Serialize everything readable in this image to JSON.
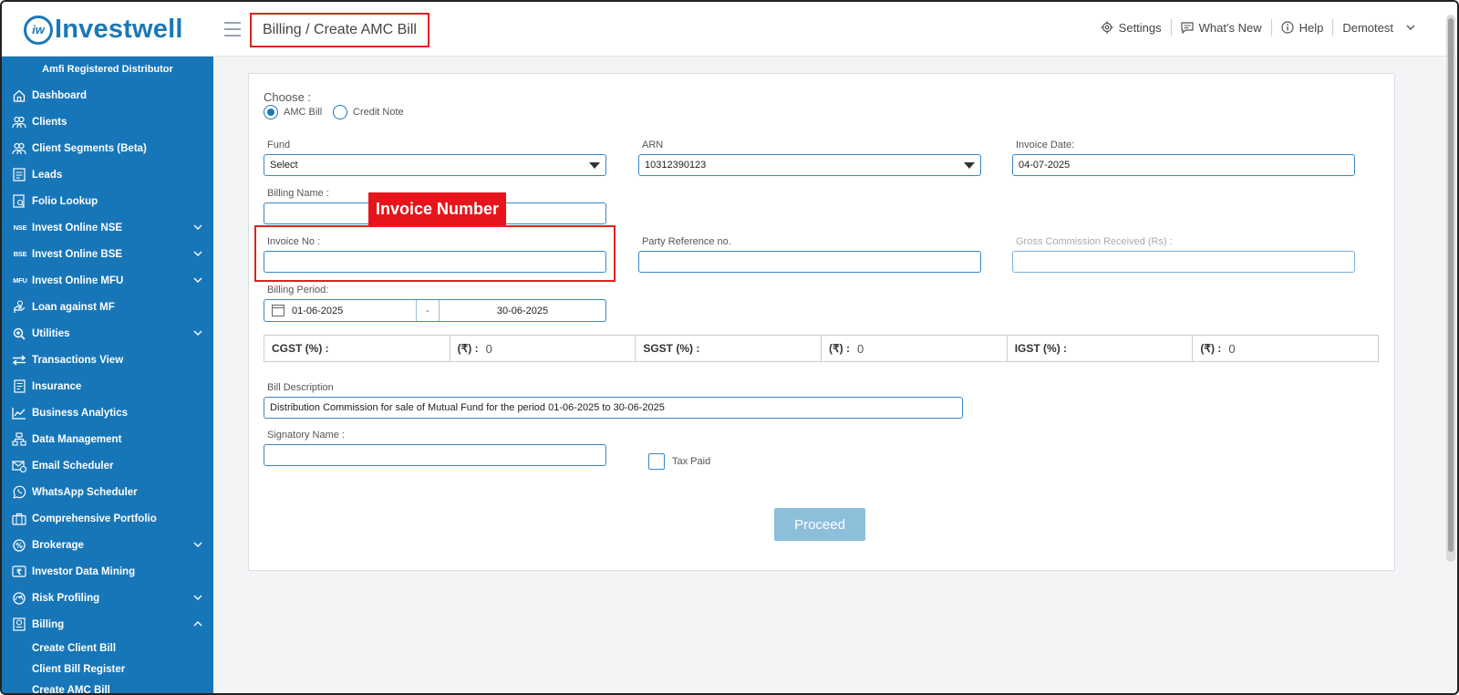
{
  "header": {
    "logo_mark": "iw",
    "logo_text": "Investwell",
    "breadcrumb": "Billing / Create AMC Bill",
    "settings": "Settings",
    "whats_new": "What's New",
    "help": "Help",
    "user": "Demotest"
  },
  "sidebar": {
    "role": "Amfi Registered Distributor",
    "items": [
      {
        "label": "Dashboard",
        "icon": "home-icon"
      },
      {
        "label": "Clients",
        "icon": "users-icon"
      },
      {
        "label": "Client Segments (Beta)",
        "icon": "users-icon"
      },
      {
        "label": "Leads",
        "icon": "leads-icon"
      },
      {
        "label": "Folio Lookup",
        "icon": "folio-icon"
      },
      {
        "label": "Invest Online NSE",
        "icon_text": "NSE"
      },
      {
        "label": "Invest Online BSE",
        "icon_text": "BSE"
      },
      {
        "label": "Invest Online MFU",
        "icon_text": "MFU"
      },
      {
        "label": "Loan against MF",
        "icon": "loan-icon"
      },
      {
        "label": "Utilities",
        "icon": "utilities-icon"
      },
      {
        "label": "Transactions View",
        "icon": "transactions-icon"
      },
      {
        "label": "Insurance",
        "icon": "insurance-icon"
      },
      {
        "label": "Business Analytics",
        "icon": "analytics-icon"
      },
      {
        "label": "Data Management",
        "icon": "data-icon"
      },
      {
        "label": "Email Scheduler",
        "icon": "email-icon"
      },
      {
        "label": "WhatsApp Scheduler",
        "icon": "whatsapp-icon"
      },
      {
        "label": "Comprehensive Portfolio",
        "icon": "portfolio-icon"
      },
      {
        "label": "Brokerage",
        "icon": "brokerage-icon"
      },
      {
        "label": "Investor Data Mining",
        "icon": "rupee-icon"
      },
      {
        "label": "Risk Profiling",
        "icon": "risk-icon"
      },
      {
        "label": "Billing",
        "icon": "billing-icon"
      }
    ],
    "billing_sub": [
      "Create Client Bill",
      "Client Bill Register",
      "Create AMC Bill"
    ]
  },
  "form": {
    "choose_label": "Choose :",
    "radio_amc": "AMC Bill",
    "radio_credit": "Credit Note",
    "fund_label": "Fund",
    "fund_value": "Select",
    "arn_label": "ARN",
    "arn_value": "10312390123",
    "invoice_date_label": "Invoice Date:",
    "invoice_date_value": "04-07-2025",
    "billing_name_label": "Billing Name :",
    "billing_name_value": "",
    "invoice_no_label": "Invoice No :",
    "invoice_no_value": "",
    "party_ref_label": "Party Reference no.",
    "party_ref_value": "",
    "gross_comm_label": "Gross Commission Received (Rs) :",
    "gross_comm_value": "",
    "billing_period_label": "Billing Period:",
    "period_from": "01-06-2025",
    "period_sep": "-",
    "period_to": "30-06-2025",
    "cgst_label": "CGST (%) :",
    "cgst_amt_label": "(₹) :",
    "cgst_amt": "0",
    "sgst_label": "SGST (%) :",
    "sgst_amt_label": "(₹) :",
    "sgst_amt": "0",
    "igst_label": "IGST (%) :",
    "igst_amt_label": "(₹) :",
    "igst_amt": "0",
    "bill_desc_label": "Bill Description",
    "bill_desc_value": "Distribution Commission for sale of Mutual Fund for the period 01-06-2025 to 30-06-2025",
    "signatory_label": "Signatory Name :",
    "signatory_value": "",
    "tax_paid_label": "Tax Paid",
    "proceed_label": "Proceed"
  },
  "annotation": {
    "label": "Invoice Number"
  },
  "colors": {
    "brand": "#1776b8",
    "annotation": "#e6151b",
    "proceed_disabled": "#8dbfdb"
  }
}
